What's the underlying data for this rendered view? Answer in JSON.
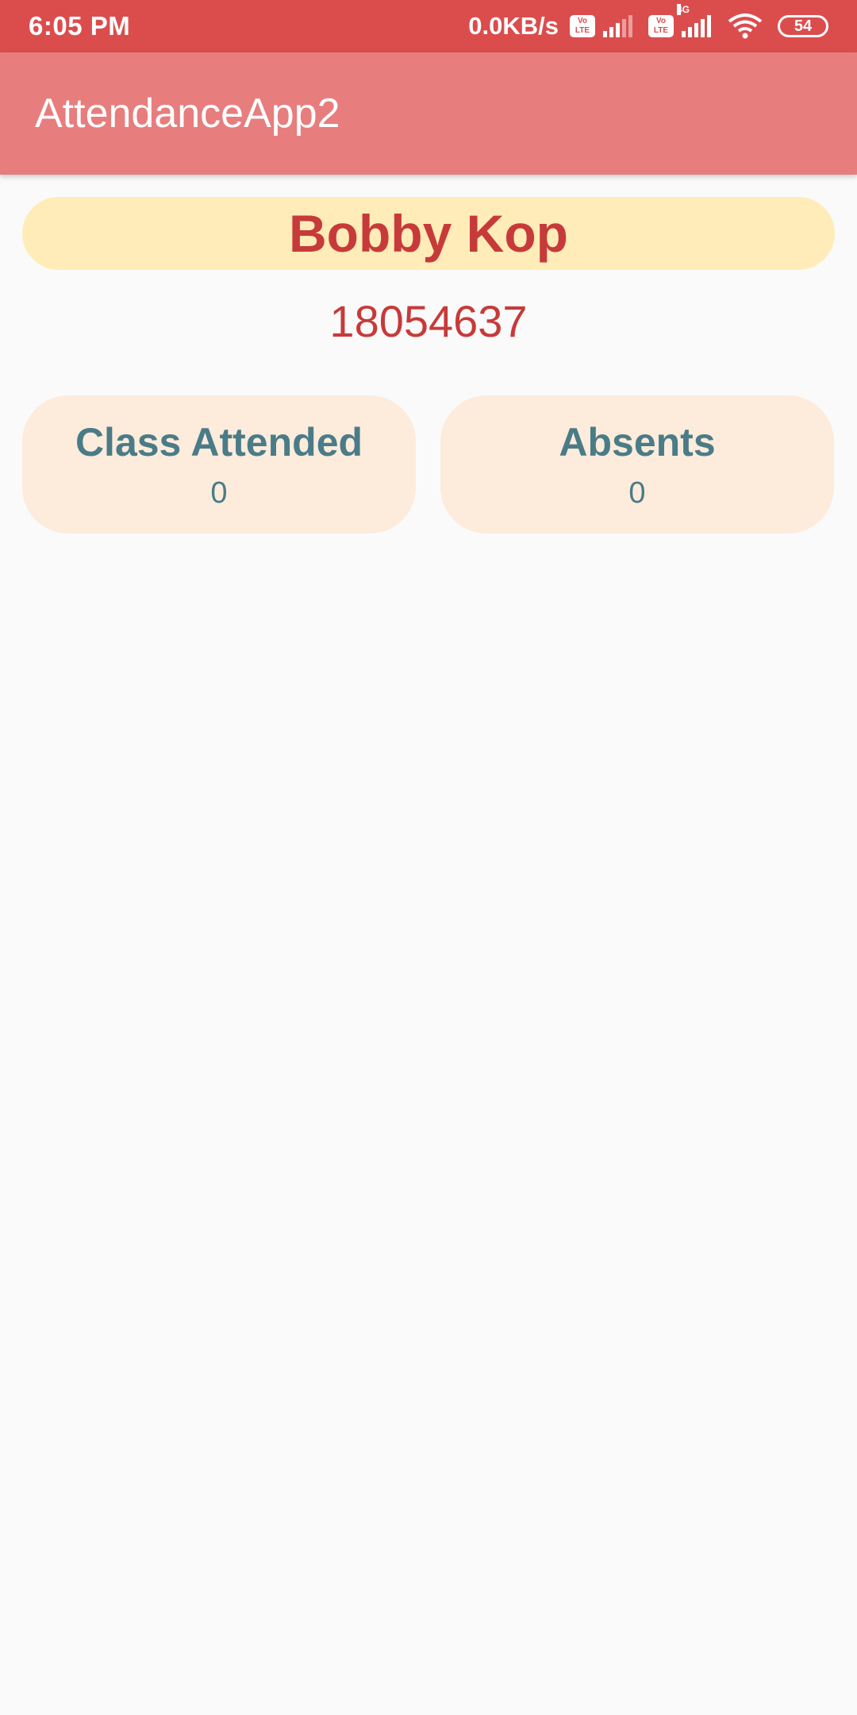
{
  "status_bar": {
    "time": "6:05 PM",
    "speed": "0.0KB/s",
    "volte1": "Vo\nLTE",
    "volte2": "Vo\nLTE",
    "network_type": "4G",
    "battery": "54"
  },
  "app_bar": {
    "title": "AttendanceApp2"
  },
  "student": {
    "name": "Bobby Kop",
    "id": "18054637"
  },
  "stats": {
    "attended_label": "Class Attended",
    "attended_value": "0",
    "absents_label": "Absents",
    "absents_value": "0"
  },
  "colors": {
    "status_bar": "#db4d4d",
    "app_bar": "#e77d7d",
    "name_pill": "#ffecb8",
    "accent_red": "#c73a3a",
    "card_bg": "#fdebdc",
    "card_text": "#4a7c87"
  }
}
